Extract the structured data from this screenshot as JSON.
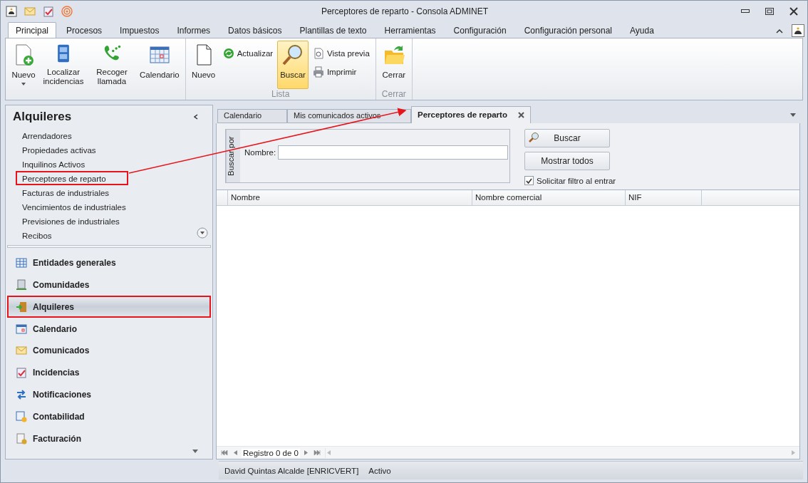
{
  "window": {
    "title": "Perceptores de reparto - Consola ADMINET"
  },
  "ribbon": {
    "tabs": [
      {
        "label": "Principal",
        "selected": true
      },
      {
        "label": "Procesos",
        "selected": false
      },
      {
        "label": "Impuestos",
        "selected": false
      },
      {
        "label": "Informes",
        "selected": false
      },
      {
        "label": "Datos básicos",
        "selected": false
      },
      {
        "label": "Plantillas de texto",
        "selected": false
      },
      {
        "label": "Herramientas",
        "selected": false
      },
      {
        "label": "Configuración",
        "selected": false
      },
      {
        "label": "Configuración personal",
        "selected": false
      },
      {
        "label": "Ayuda",
        "selected": false
      }
    ],
    "groups": [
      {
        "items": [
          {
            "label": "Nuevo",
            "kind": "large",
            "dropdown": true,
            "selected": false
          },
          {
            "label": "Localizar incidencias",
            "kind": "large",
            "selected": false
          },
          {
            "label": "Recoger llamada",
            "kind": "large",
            "selected": false
          },
          {
            "label": "Calendario",
            "kind": "large",
            "selected": false
          }
        ]
      },
      {
        "label": "Lista",
        "items": [
          {
            "label": "Nuevo",
            "kind": "large",
            "selected": false
          },
          {
            "label": "Actualizar",
            "kind": "small",
            "selected": false
          },
          {
            "label": "Buscar",
            "kind": "large",
            "selected": true
          },
          {
            "label": "Vista previa",
            "kind": "small",
            "selected": false
          },
          {
            "label": "Imprimir",
            "kind": "small",
            "selected": false
          }
        ]
      },
      {
        "label": "Cerrar",
        "items": [
          {
            "label": "Cerrar",
            "kind": "large",
            "selected": false
          }
        ]
      }
    ]
  },
  "nav": {
    "title": "Alquileres",
    "links": [
      {
        "label": "Arrendadores",
        "annotated": false
      },
      {
        "label": "Propiedades activas",
        "annotated": false
      },
      {
        "label": "Inquilinos Activos",
        "annotated": false
      },
      {
        "label": "Perceptores de reparto",
        "annotated": true
      },
      {
        "label": "Facturas de industriales",
        "annotated": false
      },
      {
        "label": "Vencimientos de industriales",
        "annotated": false
      },
      {
        "label": "Previsiones de industriales",
        "annotated": false
      },
      {
        "label": "Recibos",
        "annotated": false
      }
    ],
    "sections": [
      {
        "label": "Entidades generales",
        "selected": false,
        "annotated": false
      },
      {
        "label": "Comunidades",
        "selected": false,
        "annotated": false
      },
      {
        "label": "Alquileres",
        "selected": true,
        "annotated": true
      },
      {
        "label": "Calendario",
        "selected": false,
        "annotated": false
      },
      {
        "label": "Comunicados",
        "selected": false,
        "annotated": false
      },
      {
        "label": "Incidencias",
        "selected": false,
        "annotated": false
      },
      {
        "label": "Notificaciones",
        "selected": false,
        "annotated": false
      },
      {
        "label": "Contabilidad",
        "selected": false,
        "annotated": false
      },
      {
        "label": "Facturación",
        "selected": false,
        "annotated": false
      }
    ]
  },
  "doc_tabs": [
    {
      "label": "Calendario",
      "selected": false
    },
    {
      "label": "Mis comunicados activos",
      "selected": false
    },
    {
      "label": "Perceptores de reparto",
      "selected": true
    }
  ],
  "search": {
    "group_label": "Buscar por",
    "field_label": "Nombre:",
    "buttons": [
      "Buscar",
      "Mostrar todos"
    ],
    "checkbox": {
      "label": "Solicitar filtro al entrar",
      "checked": true
    }
  },
  "table": {
    "columns": [
      "Nombre",
      "Nombre comercial",
      "NIF"
    ]
  },
  "pager": {
    "text": "Registro 0 de 0"
  },
  "status_bar": [
    "David Quintas Alcalde [ENRICVERT]",
    "Activo"
  ]
}
